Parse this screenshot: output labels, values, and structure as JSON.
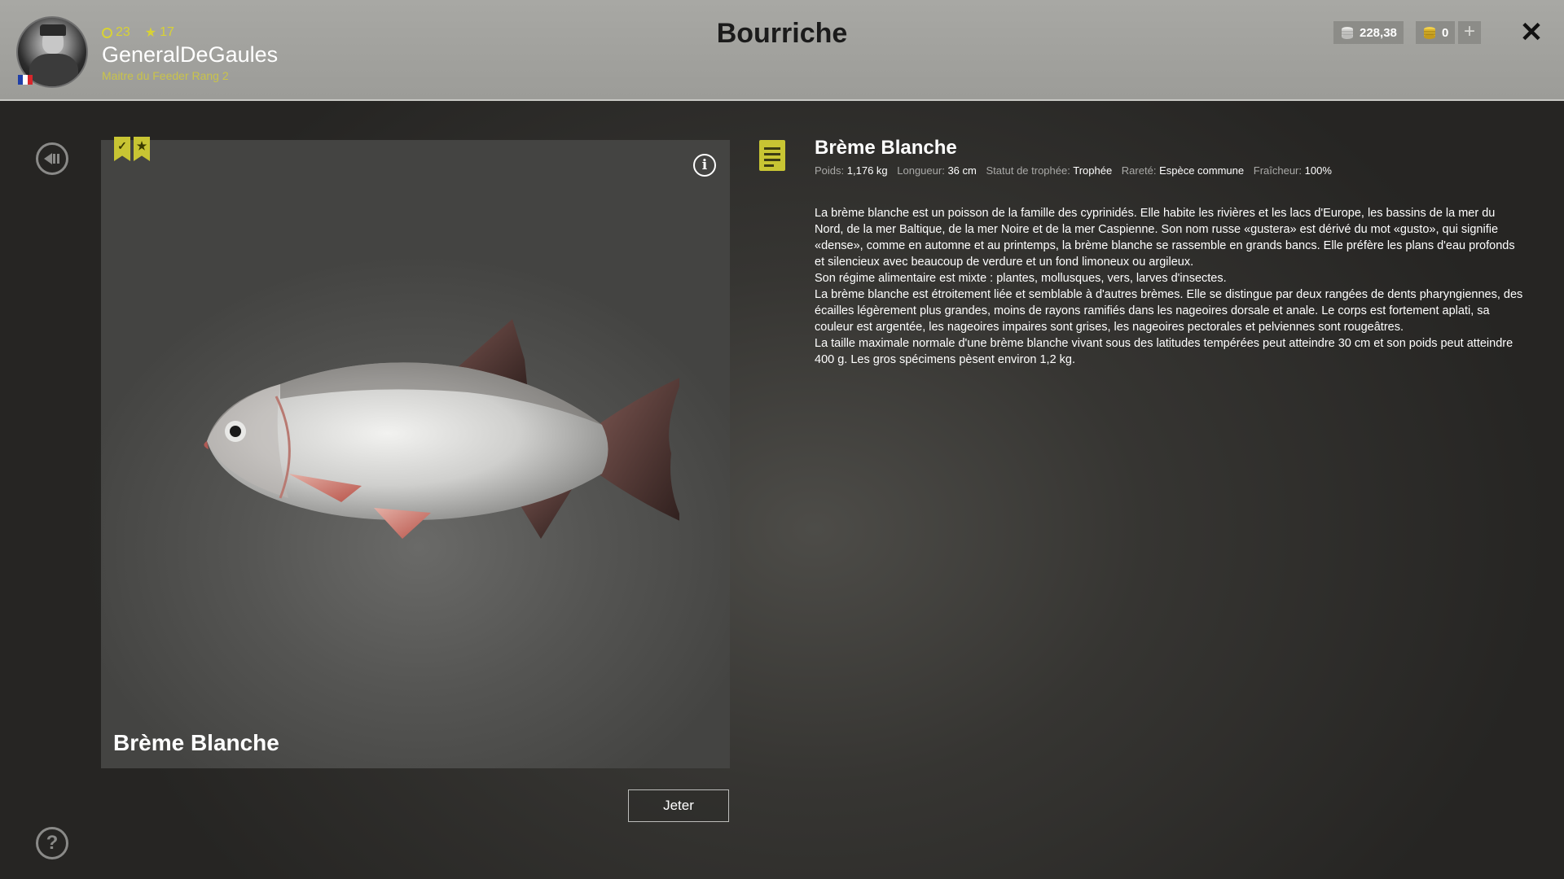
{
  "header": {
    "title": "Bourriche",
    "username": "GeneralDeGaules",
    "rank": "Maitre du Feeder Rang 2",
    "level": "23",
    "stars": "17",
    "silver": "228,38",
    "gold": "0",
    "plus_label": "+",
    "close_label": "✕",
    "flag_colors": [
      "#1f3fa8",
      "#ffffff",
      "#d8262b"
    ]
  },
  "fish": {
    "name": "Brème Blanche",
    "discard_label": "Jeter",
    "info_label": "i"
  },
  "details": {
    "title": "Brème Blanche",
    "meta": [
      {
        "label": "Poids:",
        "value": "1,176 kg"
      },
      {
        "label": "Longueur:",
        "value": "36 cm"
      },
      {
        "label": "Statut de trophée:",
        "value": "Trophée"
      },
      {
        "label": "Rareté:",
        "value": "Espèce commune"
      },
      {
        "label": "Fraîcheur:",
        "value": "100%"
      }
    ],
    "paragraphs": [
      "La brème blanche est un poisson de la famille des cyprinidés. Elle habite les rivières et les lacs d'Europe, les bassins de la mer du Nord, de la mer Baltique, de la mer Noire et de la mer Caspienne. Son nom russe «gustera» est dérivé du mot «gusto», qui signifie «dense», comme en automne et au printemps, la brème blanche se rassemble en grands bancs. Elle préfère les plans d'eau profonds et silencieux avec beaucoup de verdure et un fond limoneux ou argileux.",
      "Son régime alimentaire est mixte : plantes, mollusques, vers, larves d'insectes.",
      "La brème blanche est étroitement liée et semblable à d'autres brèmes. Elle se distingue par deux rangées de dents pharyngiennes, des écailles légèrement plus grandes, moins de rayons ramifiés dans les nageoires dorsale et anale. Le corps est fortement aplati, sa couleur est argentée, les nageoires impaires sont grises, les nageoires pectorales et pelviennes sont rougeâtres.",
      " La taille maximale normale d'une brème blanche vivant sous des latitudes tempérées peut atteindre 30 cm et son poids peut atteindre 400 g. Les gros spécimens pèsent environ 1,2 kg."
    ]
  },
  "help_label": "?",
  "colors": {
    "accent": "#c8c533"
  }
}
